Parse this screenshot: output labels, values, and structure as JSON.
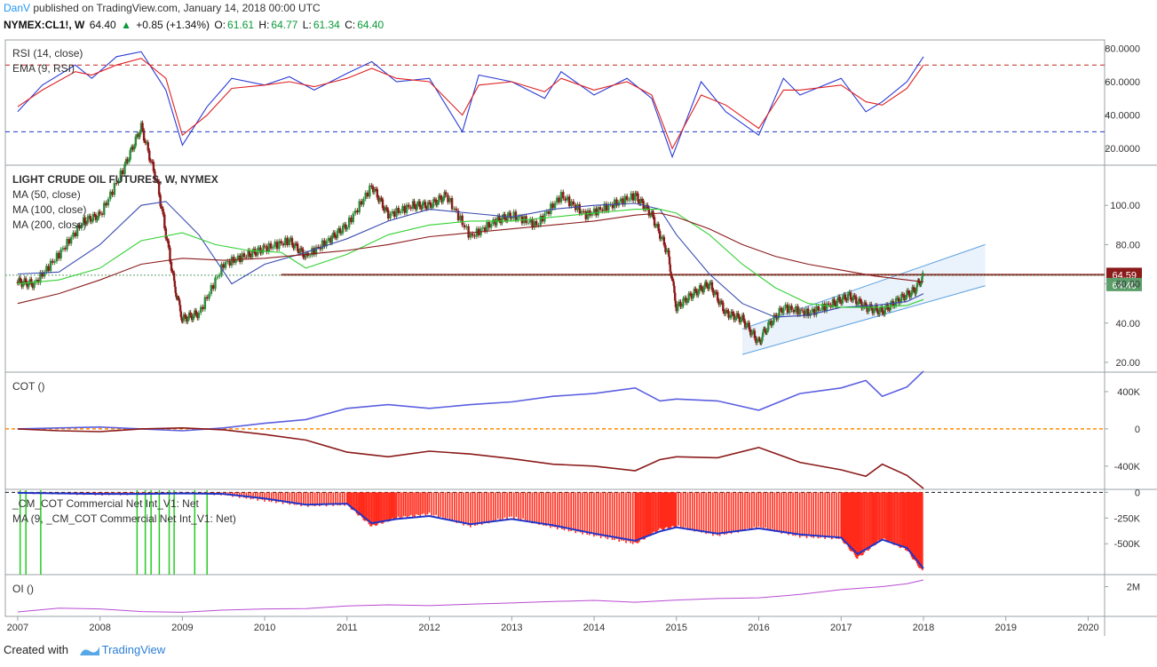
{
  "header": {
    "user": "DanV",
    "published_text": "published on TradingView.com, January 14, 2018 00:00 UTC",
    "symbol": "NYMEX:CL1!, W",
    "last": "64.40",
    "change": "+0.85 (+1.34%)",
    "o_label": "O:",
    "o": "61.61",
    "h_label": "H:",
    "h": "64.77",
    "l_label": "L:",
    "l": "61.34",
    "c_label": "C:",
    "c": "64.40"
  },
  "footer": {
    "created_with": "Created with",
    "brand": "TradingView"
  },
  "colors": {
    "up_candle": "#2e8b3a",
    "down_candle": "#8b1a1a",
    "rsi": "#2a3cd6",
    "ema": "#e02020",
    "ma50": "#3a4bb0",
    "ma100": "#33d133",
    "ma200": "#8b1a1a",
    "cot_comm": "#8b1a1a",
    "cot_spec": "#5b5fe0",
    "zero_line": "#ff8c00",
    "net_bar": "#ff2a1a",
    "ma9": "#1f35c9",
    "oi": "#b84bd3",
    "channel": "#5aa0e0",
    "level_badge": "#8b1a1a",
    "price_badge": "#5b9e6a"
  },
  "chart_data": [
    {
      "type": "line",
      "name": "rsi-panel",
      "labels": [
        "RSI (14, close)",
        "EMA (9, RSI)"
      ],
      "ylim": [
        10,
        85
      ],
      "ticks": [
        "80.0000",
        "60.0000",
        "40.0000",
        "20.0000"
      ],
      "tick_values": [
        80,
        60,
        40,
        20
      ],
      "levels": [
        70,
        30
      ],
      "series": [
        {
          "name": "RSI (14, close)",
          "x": [
            2007.0,
            2007.3,
            2007.7,
            2007.9,
            2008.2,
            2008.5,
            2008.8,
            2009.0,
            2009.3,
            2009.6,
            2010.0,
            2010.3,
            2010.6,
            2011.0,
            2011.3,
            2011.6,
            2012.0,
            2012.4,
            2012.6,
            2013.0,
            2013.4,
            2013.6,
            2014.0,
            2014.4,
            2014.7,
            2014.95,
            2015.3,
            2015.6,
            2016.0,
            2016.3,
            2016.5,
            2017.0,
            2017.3,
            2017.5,
            2017.8,
            2018.0
          ],
          "y": [
            42,
            58,
            70,
            62,
            75,
            78,
            55,
            22,
            45,
            62,
            58,
            63,
            55,
            65,
            72,
            60,
            62,
            30,
            64,
            60,
            50,
            66,
            52,
            62,
            50,
            15,
            60,
            42,
            28,
            62,
            52,
            62,
            42,
            48,
            60,
            75
          ]
        },
        {
          "name": "EMA (9, RSI)",
          "x": [
            2007.0,
            2007.3,
            2007.7,
            2007.9,
            2008.2,
            2008.5,
            2008.8,
            2009.0,
            2009.3,
            2009.6,
            2010.0,
            2010.3,
            2010.6,
            2011.0,
            2011.3,
            2011.6,
            2012.0,
            2012.4,
            2012.6,
            2013.0,
            2013.4,
            2013.6,
            2014.0,
            2014.4,
            2014.7,
            2014.95,
            2015.3,
            2015.6,
            2016.0,
            2016.3,
            2016.5,
            2017.0,
            2017.3,
            2017.5,
            2017.8,
            2018.0
          ],
          "y": [
            45,
            55,
            66,
            64,
            70,
            74,
            62,
            28,
            40,
            56,
            58,
            60,
            57,
            62,
            68,
            62,
            60,
            40,
            58,
            60,
            54,
            62,
            55,
            60,
            52,
            20,
            52,
            46,
            32,
            55,
            55,
            58,
            48,
            46,
            56,
            70
          ]
        }
      ]
    },
    {
      "type": "line",
      "name": "price-panel",
      "labels": [
        "LIGHT CRUDE OIL FUTURES, W, NYMEX",
        "MA (50, close)",
        "MA (100, close)",
        "MA (200, close)"
      ],
      "ylim": [
        15,
        120
      ],
      "ticks": [
        "100.00",
        "80.00",
        "60.00",
        "40.00",
        "20.00"
      ],
      "tick_values": [
        100,
        80,
        60,
        40,
        20
      ],
      "level_badge": "64.59",
      "level_value": 64.59,
      "price_badge": "64.40",
      "price_value": 64.4,
      "series": [
        {
          "name": "close",
          "x": [
            2007.0,
            2007.2,
            2007.5,
            2007.8,
            2008.0,
            2008.3,
            2008.5,
            2008.7,
            2008.9,
            2009.0,
            2009.2,
            2009.5,
            2009.8,
            2010.0,
            2010.3,
            2010.5,
            2010.8,
            2011.0,
            2011.3,
            2011.5,
            2011.8,
            2012.0,
            2012.2,
            2012.5,
            2012.8,
            2013.0,
            2013.3,
            2013.6,
            2013.9,
            2014.2,
            2014.5,
            2014.7,
            2014.9,
            2015.0,
            2015.2,
            2015.4,
            2015.6,
            2015.8,
            2016.0,
            2016.1,
            2016.3,
            2016.6,
            2016.9,
            2017.1,
            2017.3,
            2017.5,
            2017.7,
            2017.9,
            2018.0
          ],
          "y": [
            61,
            60,
            75,
            92,
            95,
            120,
            140,
            110,
            60,
            42,
            45,
            70,
            75,
            78,
            82,
            74,
            83,
            90,
            110,
            95,
            100,
            100,
            105,
            84,
            92,
            95,
            90,
            105,
            95,
            100,
            105,
            95,
            75,
            48,
            55,
            60,
            45,
            42,
            30,
            38,
            48,
            45,
            50,
            54,
            48,
            46,
            52,
            57,
            64.4
          ]
        },
        {
          "name": "MA (50, close)",
          "x": [
            2007.0,
            2007.5,
            2008.0,
            2008.5,
            2008.8,
            2009.2,
            2009.6,
            2010.0,
            2010.5,
            2011.0,
            2011.5,
            2012.0,
            2012.5,
            2013.0,
            2013.5,
            2014.0,
            2014.5,
            2014.8,
            2015.0,
            2015.4,
            2015.8,
            2016.2,
            2016.6,
            2017.0,
            2017.4,
            2017.8,
            2018.0
          ],
          "y": [
            65,
            66,
            80,
            100,
            102,
            85,
            60,
            70,
            76,
            83,
            92,
            98,
            96,
            94,
            98,
            100,
            101,
            98,
            85,
            65,
            50,
            43,
            44,
            48,
            49,
            51,
            55
          ]
        },
        {
          "name": "MA (100, close)",
          "x": [
            2007.0,
            2007.5,
            2008.0,
            2008.5,
            2009.0,
            2009.4,
            2009.8,
            2010.2,
            2010.5,
            2011.0,
            2011.5,
            2012.0,
            2012.5,
            2013.0,
            2013.5,
            2014.0,
            2014.5,
            2014.8,
            2015.0,
            2015.4,
            2015.8,
            2016.2,
            2016.6,
            2017.0,
            2017.4,
            2017.8,
            2018.0
          ],
          "y": [
            60,
            62,
            68,
            82,
            86,
            80,
            77,
            76,
            68,
            75,
            85,
            90,
            92,
            92,
            94,
            96,
            98,
            98,
            96,
            85,
            70,
            58,
            50,
            48,
            48,
            49,
            52
          ]
        },
        {
          "name": "MA (200, close)",
          "x": [
            2007.0,
            2007.5,
            2008.0,
            2008.5,
            2009.0,
            2009.5,
            2010.0,
            2010.5,
            2011.0,
            2011.5,
            2012.0,
            2012.5,
            2013.0,
            2013.5,
            2014.0,
            2014.5,
            2014.8,
            2015.0,
            2015.4,
            2015.8,
            2016.2,
            2016.6,
            2017.0,
            2017.4,
            2017.8,
            2018.0
          ],
          "y": [
            50,
            55,
            62,
            70,
            73,
            72,
            73,
            75,
            77,
            80,
            84,
            86,
            88,
            90,
            92,
            95,
            96,
            94,
            88,
            80,
            74,
            70,
            67,
            64,
            62,
            61
          ]
        }
      ],
      "channel": {
        "x": [
          2015.8,
          2018.75
        ],
        "lower": [
          24,
          59
        ],
        "upper": [
          37,
          80
        ]
      }
    },
    {
      "type": "line",
      "name": "cot-panel",
      "labels": [
        "COT ()"
      ],
      "ylim": [
        -650000,
        600000
      ],
      "ticks": [
        "400K",
        "0",
        "-400K"
      ],
      "tick_values": [
        400000,
        0,
        -400000
      ],
      "series": [
        {
          "name": "speculators",
          "x": [
            2007.0,
            2007.5,
            2008.0,
            2008.5,
            2009.0,
            2009.5,
            2010.0,
            2010.5,
            2011.0,
            2011.5,
            2012.0,
            2012.5,
            2013.0,
            2013.5,
            2014.0,
            2014.5,
            2014.8,
            2015.0,
            2015.5,
            2016.0,
            2016.5,
            2017.0,
            2017.3,
            2017.5,
            2017.8,
            2018.0
          ],
          "y": [
            0,
            10000,
            20000,
            0,
            -20000,
            10000,
            60000,
            100000,
            220000,
            260000,
            220000,
            260000,
            290000,
            350000,
            380000,
            440000,
            300000,
            320000,
            300000,
            200000,
            380000,
            440000,
            520000,
            350000,
            450000,
            620000
          ]
        },
        {
          "name": "commercials",
          "x": [
            2007.0,
            2007.5,
            2008.0,
            2008.5,
            2009.0,
            2009.5,
            2010.0,
            2010.5,
            2011.0,
            2011.5,
            2012.0,
            2012.5,
            2013.0,
            2013.5,
            2014.0,
            2014.5,
            2014.8,
            2015.0,
            2015.5,
            2016.0,
            2016.5,
            2017.0,
            2017.3,
            2017.5,
            2017.8,
            2018.0
          ],
          "y": [
            0,
            -20000,
            -30000,
            0,
            10000,
            -10000,
            -60000,
            -120000,
            -250000,
            -300000,
            -240000,
            -270000,
            -320000,
            -380000,
            -400000,
            -450000,
            -330000,
            -300000,
            -310000,
            -200000,
            -360000,
            -440000,
            -510000,
            -380000,
            -500000,
            -640000
          ]
        }
      ]
    },
    {
      "type": "bar",
      "name": "net-panel",
      "labels": [
        "_CM_COT Commercial Net Int_V1: Net",
        "MA (9, _CM_COT Commercial Net Int_V1: Net)"
      ],
      "ylim": [
        -800000,
        20000
      ],
      "ticks": [
        "0",
        "-250K",
        "-500K"
      ],
      "tick_values": [
        0,
        -250000,
        -500000
      ],
      "series": [
        {
          "name": "Net",
          "x": [
            2007.0,
            2007.5,
            2008.0,
            2008.5,
            2009.0,
            2009.5,
            2010.0,
            2010.5,
            2011.0,
            2011.3,
            2011.6,
            2012.0,
            2012.5,
            2013.0,
            2013.5,
            2014.0,
            2014.5,
            2014.8,
            2015.0,
            2015.5,
            2016.0,
            2016.5,
            2017.0,
            2017.2,
            2017.5,
            2017.8,
            2018.0
          ],
          "y": [
            -5000,
            -10000,
            -20000,
            -15000,
            -5000,
            -20000,
            -80000,
            -130000,
            -120000,
            -330000,
            -250000,
            -210000,
            -330000,
            -240000,
            -340000,
            -420000,
            -500000,
            -360000,
            -330000,
            -420000,
            -340000,
            -430000,
            -450000,
            -640000,
            -450000,
            -560000,
            -780000
          ]
        },
        {
          "name": "MA (9)",
          "x": [
            2007.0,
            2007.5,
            2008.0,
            2008.5,
            2009.0,
            2009.5,
            2010.0,
            2010.5,
            2011.0,
            2011.3,
            2011.6,
            2012.0,
            2012.5,
            2013.0,
            2013.5,
            2014.0,
            2014.5,
            2014.8,
            2015.0,
            2015.5,
            2016.0,
            2016.5,
            2017.0,
            2017.2,
            2017.5,
            2017.8,
            2018.0
          ],
          "y": [
            -5000,
            -10000,
            -15000,
            -15000,
            -10000,
            -15000,
            -60000,
            -120000,
            -110000,
            -300000,
            -260000,
            -230000,
            -310000,
            -260000,
            -320000,
            -400000,
            -470000,
            -380000,
            -340000,
            -400000,
            -350000,
            -410000,
            -440000,
            -600000,
            -460000,
            -540000,
            -740000
          ]
        }
      ],
      "signal_years": [
        2007.03,
        2007.1,
        2007.28,
        2008.45,
        2008.55,
        2008.62,
        2008.72,
        2008.84,
        2008.9,
        2009.15,
        2009.3
      ]
    },
    {
      "type": "line",
      "name": "oi-panel",
      "labels": [
        "OI ()"
      ],
      "ylim": [
        1200000,
        2300000
      ],
      "ticks": [
        "2M"
      ],
      "tick_values": [
        2000000
      ],
      "series": [
        {
          "name": "OI ()",
          "x": [
            2007.0,
            2007.5,
            2008.0,
            2008.5,
            2009.0,
            2009.5,
            2010.0,
            2010.5,
            2011.0,
            2011.5,
            2012.0,
            2012.5,
            2013.0,
            2013.5,
            2014.0,
            2014.5,
            2015.0,
            2015.5,
            2016.0,
            2016.5,
            2017.0,
            2017.5,
            2017.8,
            2018.0
          ],
          "y": [
            1320000,
            1420000,
            1400000,
            1330000,
            1310000,
            1370000,
            1400000,
            1410000,
            1480000,
            1510000,
            1490000,
            1530000,
            1560000,
            1600000,
            1630000,
            1580000,
            1640000,
            1680000,
            1700000,
            1790000,
            1920000,
            2000000,
            2080000,
            2180000
          ]
        }
      ]
    },
    {
      "type": "axis",
      "name": "time-axis",
      "ticks": [
        "2007",
        "2008",
        "2009",
        "2010",
        "2011",
        "2012",
        "2013",
        "2014",
        "2015",
        "2016",
        "2017",
        "2018",
        "2019",
        "2020"
      ],
      "tick_values": [
        2007,
        2008,
        2009,
        2010,
        2011,
        2012,
        2013,
        2014,
        2015,
        2016,
        2017,
        2018,
        2019,
        2020
      ],
      "xlim": [
        2006.85,
        2020.2
      ]
    }
  ]
}
